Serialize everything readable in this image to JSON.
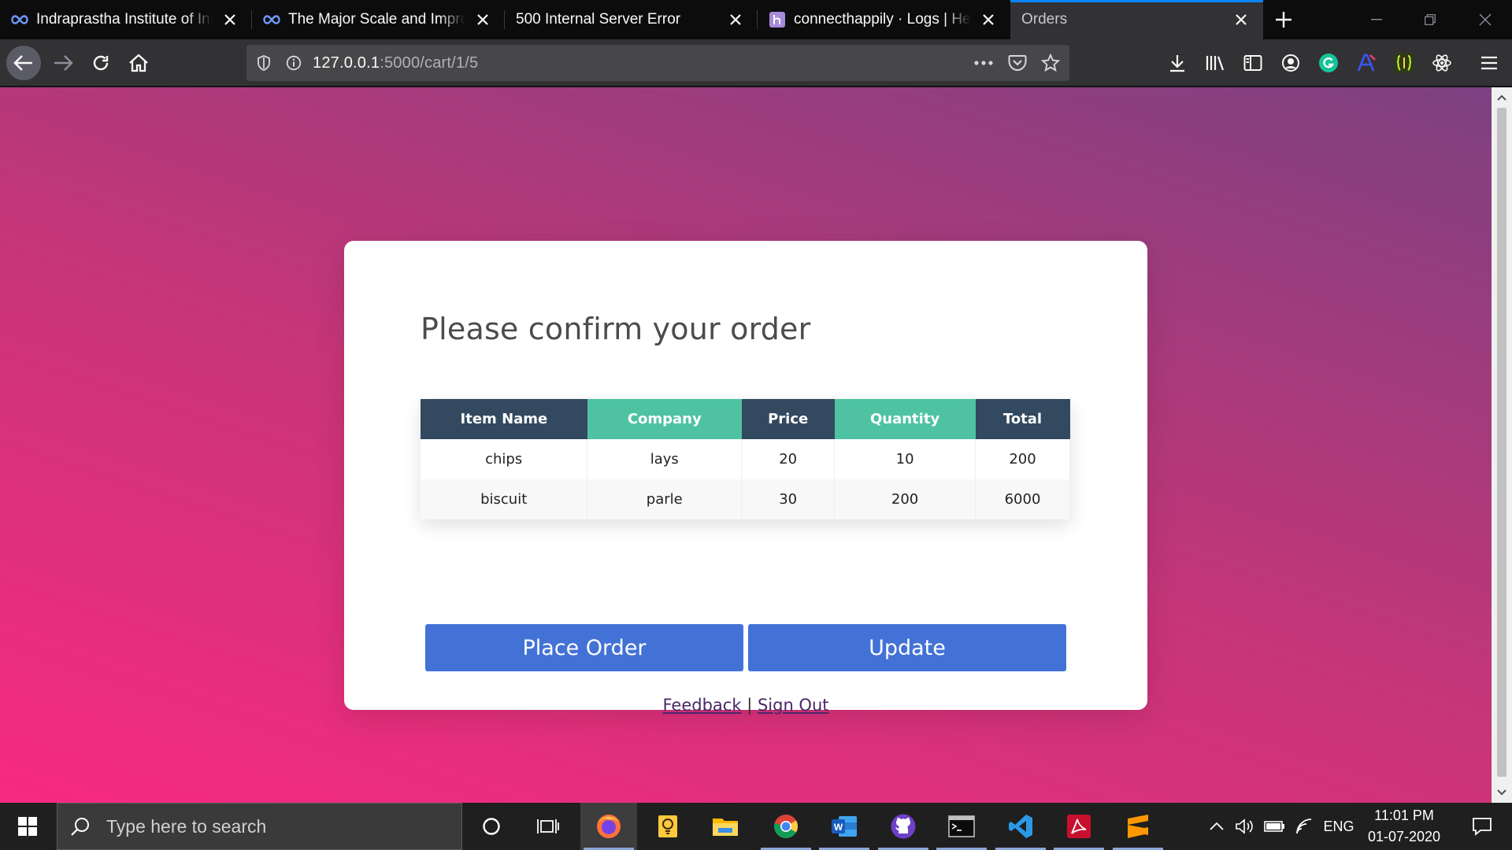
{
  "browser": {
    "tabs": [
      {
        "title": "Indraprastha Institute of Information",
        "favicon": "infinity-icon"
      },
      {
        "title": "The Major Scale and Improvising",
        "favicon": "infinity-icon"
      },
      {
        "title": "500 Internal Server Error",
        "favicon": ""
      },
      {
        "title": "connecthappily · Logs | Heroku",
        "favicon": "heroku-icon"
      },
      {
        "title": "Orders",
        "favicon": "",
        "active": true
      }
    ],
    "url": {
      "host": "127.0.0.1",
      "rest": ":5000/cart/1/5"
    }
  },
  "page": {
    "heading": "Please confirm your order",
    "table": {
      "headers": [
        "Item Name",
        "Company",
        "Price",
        "Quantity",
        "Total"
      ],
      "rows": [
        [
          "chips",
          "lays",
          "20",
          "10",
          "200"
        ],
        [
          "biscuit",
          "parle",
          "30",
          "200",
          "6000"
        ]
      ]
    },
    "buttons": {
      "place_order": "Place Order",
      "update": "Update"
    },
    "links": {
      "feedback": "Feedback",
      "separator": "|",
      "sign_out": "Sign Out"
    }
  },
  "taskbar": {
    "search_placeholder": "Type here to search",
    "language": "ENG",
    "time": "11:01 PM",
    "date": "01-07-2020"
  },
  "colors": {
    "header_dark": "#324960",
    "header_teal": "#4fc3a1",
    "button": "#4372d6",
    "link": "#4a2668",
    "tab_active_accent": "#0a84ff"
  }
}
